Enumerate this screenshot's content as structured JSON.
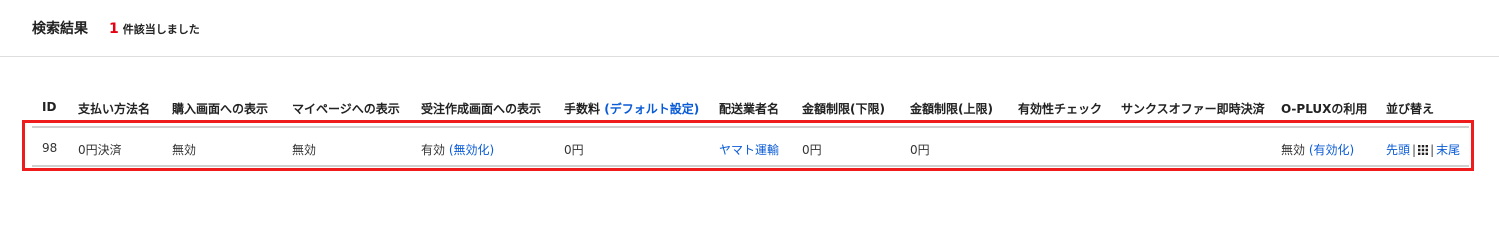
{
  "result_header": {
    "title": "検索結果",
    "count": "1",
    "count_suffix": "件該当しました"
  },
  "table": {
    "columns": {
      "id": "ID",
      "payment_method": "支払い方法名",
      "purchase_display": "購入画面への表示",
      "mypage_display": "マイページへの表示",
      "order_display": "受注作成画面への表示",
      "fee": "手数料",
      "fee_default_link": "(デフォルト設定)",
      "carrier": "配送業者名",
      "amount_min": "金額制限(下限)",
      "amount_max": "金額制限(上限)",
      "validity_check": "有効性チェック",
      "thanks_offer": "サンクスオファー即時決済",
      "oplux": "O-PLUXの利用",
      "sort": "並び替え"
    },
    "rows": [
      {
        "id": "98",
        "payment_method": "0円決済",
        "purchase_display": "無効",
        "mypage_display": "無効",
        "order_display": "有効",
        "order_display_action": "(無効化)",
        "fee": "0円",
        "carrier": "ヤマト運輸",
        "amount_min": "0円",
        "amount_max": "0円",
        "validity_check": "",
        "thanks_offer": "",
        "oplux": "無効",
        "oplux_action": "(有効化)",
        "sort_first": "先頭",
        "sort_sep": "|",
        "sort_handle_icon": "grid-icon",
        "sort_last": "末尾"
      }
    ]
  },
  "colors": {
    "count": "#e60012",
    "link": "#0a5bd6",
    "highlight": "#ee1c1c"
  }
}
